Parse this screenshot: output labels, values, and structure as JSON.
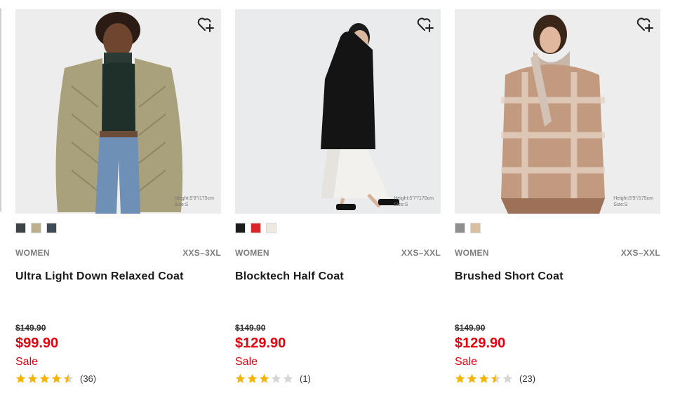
{
  "products": [
    {
      "gender": "WOMEN",
      "size_range": "XXS–3XL",
      "name": "Ultra Light Down Relaxed Coat",
      "original_price": "$149.90",
      "price": "$99.90",
      "sale_label": "Sale",
      "rating": 4.5,
      "review_count": "(36)",
      "model_height": "Height:5'9\"/175cm",
      "model_size": "Size:S",
      "swatches": [
        "#3d4348",
        "#bdb08c",
        "#3e4a56"
      ]
    },
    {
      "gender": "WOMEN",
      "size_range": "XXS–XXL",
      "name": "Blocktech Half Coat",
      "original_price": "$149.90",
      "price": "$129.90",
      "sale_label": "Sale",
      "rating": 3,
      "review_count": "(1)",
      "model_height": "Height:5'7\"/170cm",
      "model_size": "Size:S",
      "swatches": [
        "#1c1c1c",
        "#d9262b",
        "#efe9e3"
      ]
    },
    {
      "gender": "WOMEN",
      "size_range": "XXS–XXL",
      "name": "Brushed Short Coat",
      "original_price": "$149.90",
      "price": "$129.90",
      "sale_label": "Sale",
      "rating": 3.5,
      "review_count": "(23)",
      "model_height": "Height:5'9\"/175cm",
      "model_size": "Size:S",
      "swatches": [
        "#8f8f8f",
        "#d8bfa0"
      ]
    }
  ],
  "icons": {
    "wishlist": "heart-plus-icon",
    "star": "star-icon"
  },
  "colors": {
    "sale_red": "#e5000f",
    "star_gold": "#f5b400",
    "star_empty": "#d6d6d6",
    "meta_gray": "#7d7d7d"
  }
}
